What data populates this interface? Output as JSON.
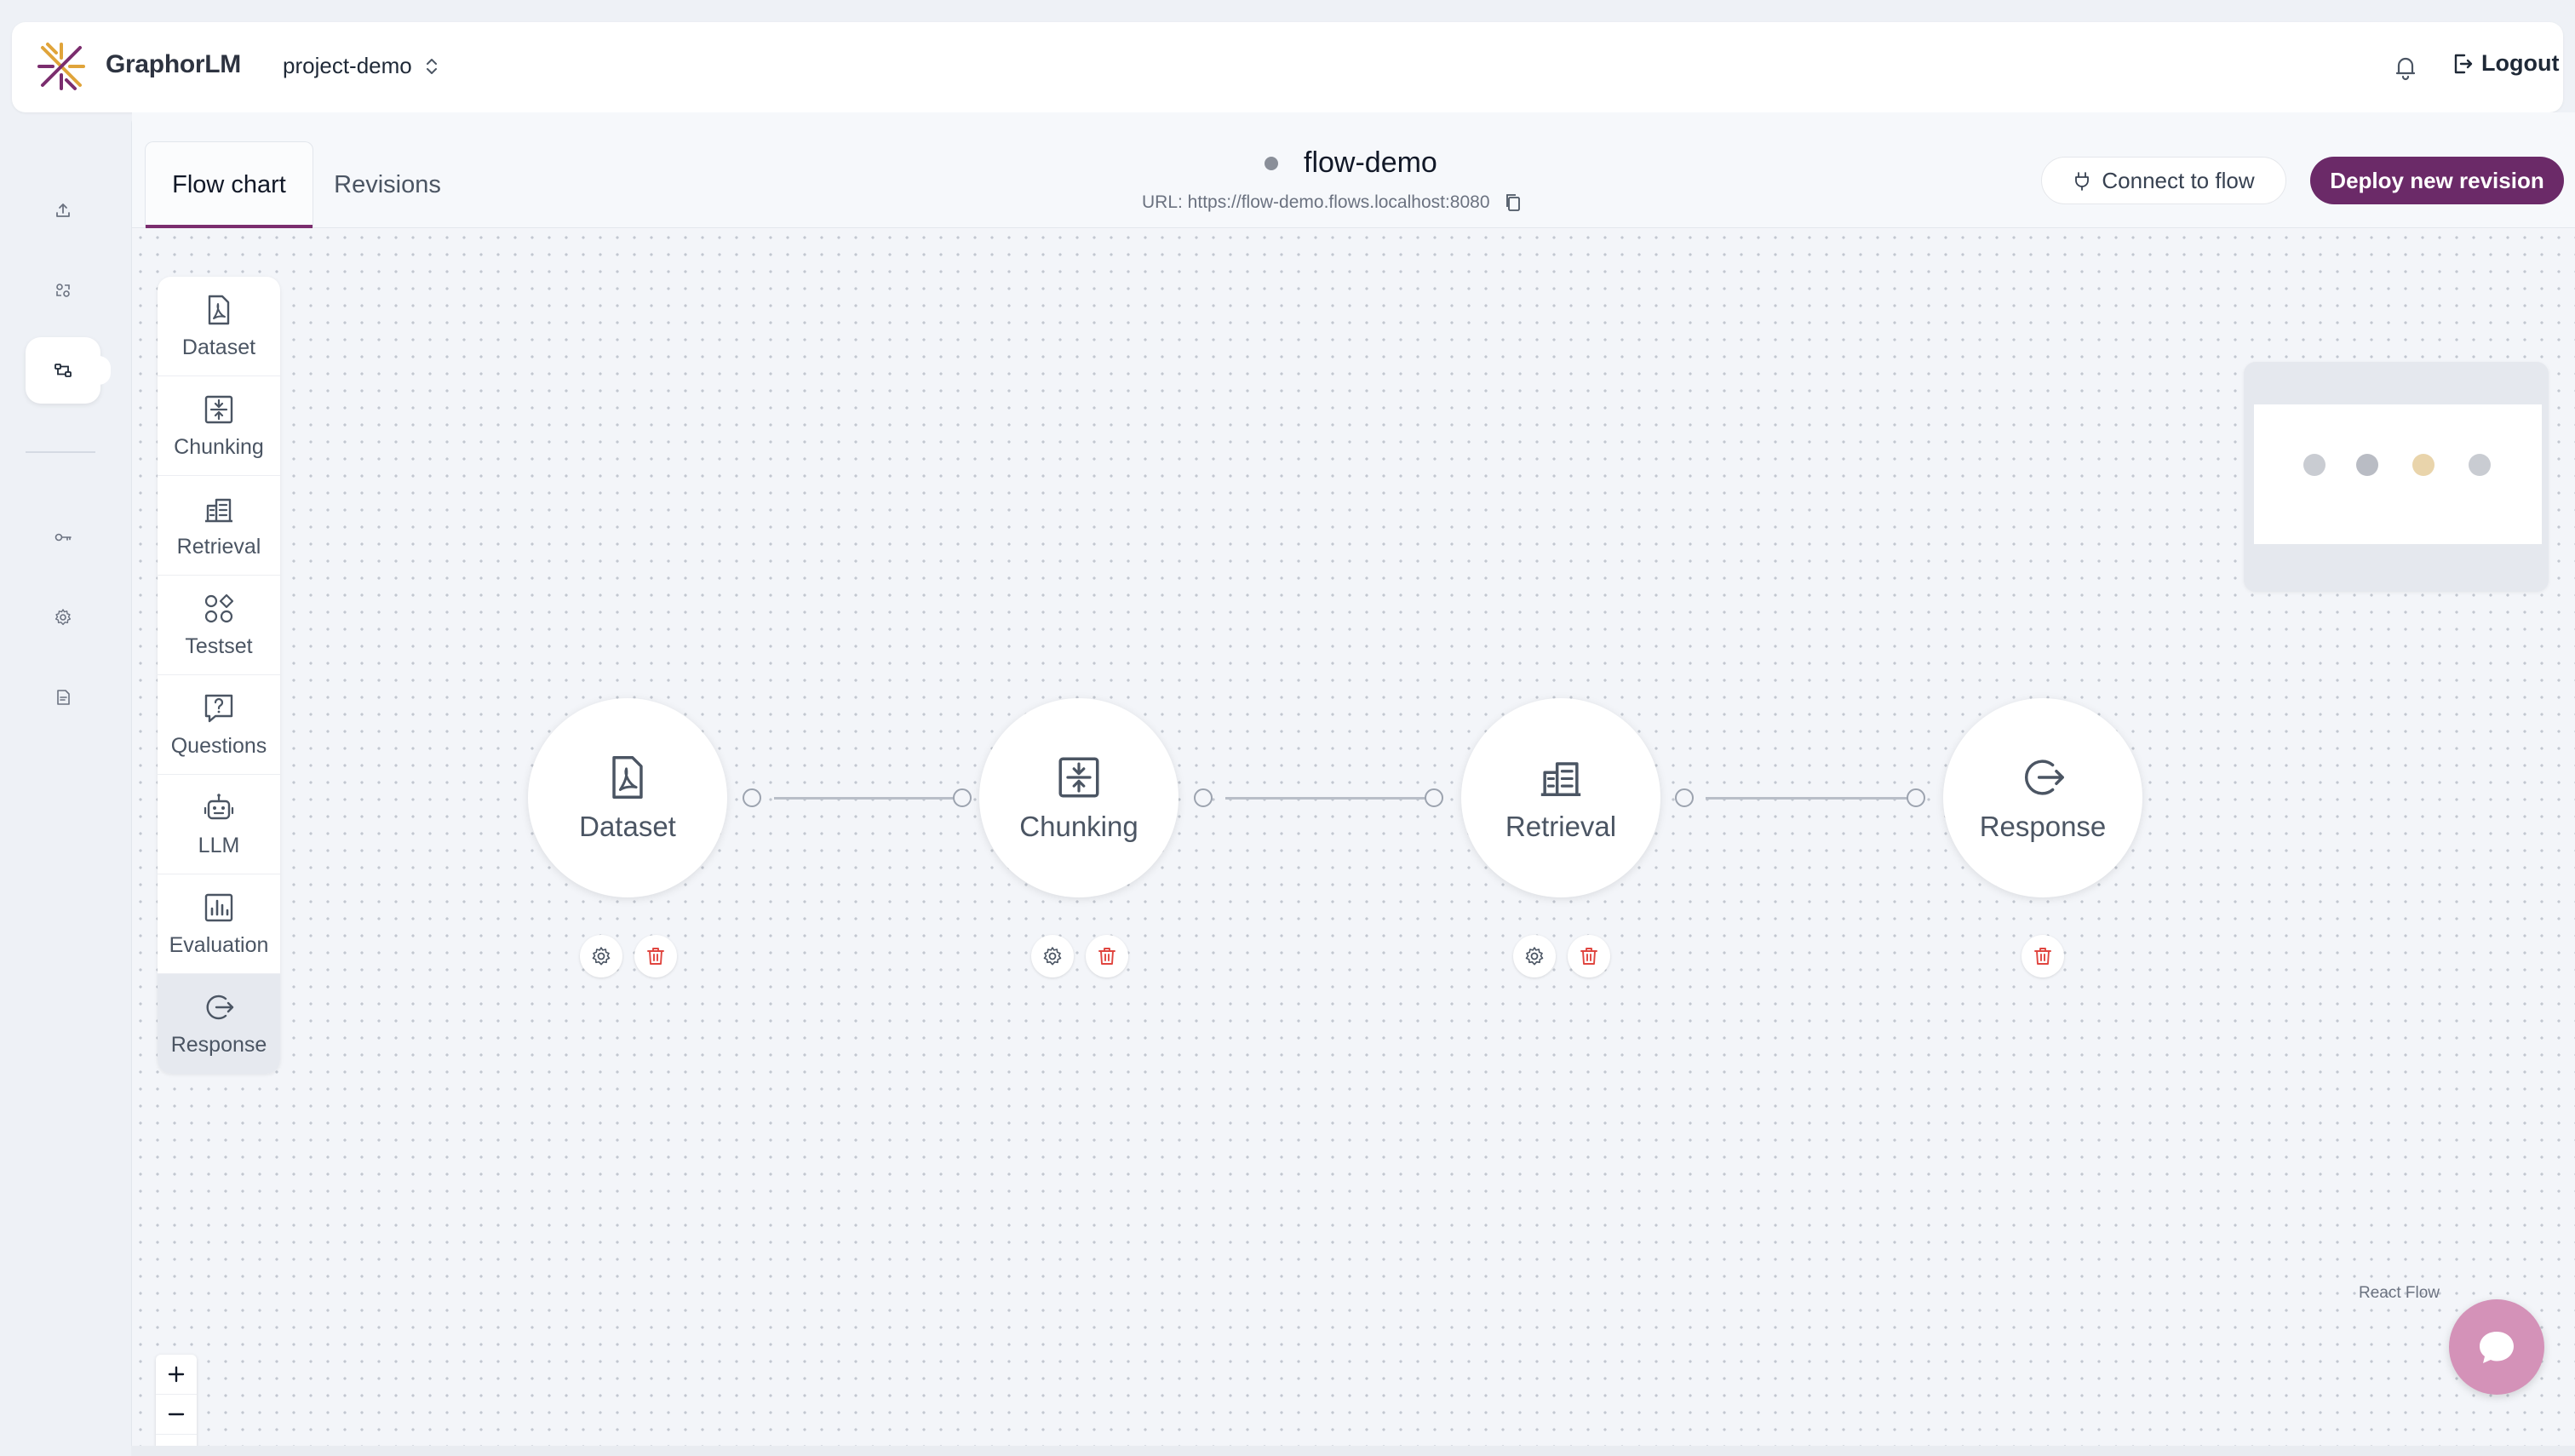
{
  "header": {
    "brand": "GraphorLM",
    "project": "project-demo",
    "logout_label": "Logout"
  },
  "rail": {
    "items": [
      "upload-icon",
      "integrations-icon",
      "flows-icon",
      "key-icon",
      "settings-icon",
      "docs-icon"
    ],
    "active": "flows-icon"
  },
  "tabs": [
    {
      "label": "Flow chart",
      "active": true
    },
    {
      "label": "Revisions",
      "active": false
    }
  ],
  "flow": {
    "name": "flow-demo",
    "url": "URL: https://flow-demo.flows.localhost:8080",
    "status_color": "#8a8f99"
  },
  "actions": {
    "connect_label": "Connect to flow",
    "deploy_label": "Deploy new revision"
  },
  "palette": [
    {
      "label": "Dataset",
      "icon": "pdf-file-icon"
    },
    {
      "label": "Chunking",
      "icon": "chunking-icon"
    },
    {
      "label": "Retrieval",
      "icon": "retrieval-icon"
    },
    {
      "label": "Testset",
      "icon": "testset-icon"
    },
    {
      "label": "Questions",
      "icon": "question-icon"
    },
    {
      "label": "LLM",
      "icon": "robot-icon"
    },
    {
      "label": "Evaluation",
      "icon": "bar-chart-icon"
    },
    {
      "label": "Response",
      "icon": "response-icon",
      "active": true
    }
  ],
  "nodes": [
    {
      "label": "Dataset",
      "icon": "pdf-file-icon",
      "has_settings": true
    },
    {
      "label": "Chunking",
      "icon": "chunking-icon",
      "has_settings": true
    },
    {
      "label": "Retrieval",
      "icon": "retrieval-icon",
      "has_settings": true
    },
    {
      "label": "Response",
      "icon": "response-icon",
      "has_settings": false
    }
  ],
  "minimap": {
    "dot_colors": [
      "#c9ccd2",
      "#b9bcc4",
      "#e9d4ab",
      "#c9ccd2"
    ]
  },
  "attribution": "React Flow",
  "colors": {
    "accent": "#6b2a68",
    "delete": "#e0453f",
    "chat": "#d492b8"
  }
}
